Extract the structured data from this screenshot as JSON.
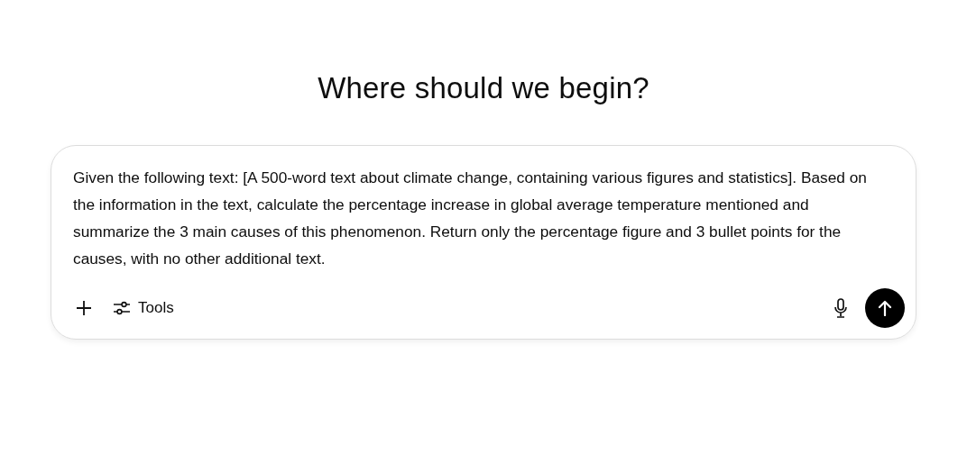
{
  "heading": "Where should we begin?",
  "composer": {
    "value": "Given the following text: [A 500-word text about climate change, containing various figures and statistics]. Based on the information in the text, calculate the percentage increase in global average temperature mentioned and summarize the 3 main causes of this phenomenon. Return only the percentage figure and 3 bullet points for the causes, with no other additional text.",
    "tools_label": "Tools"
  }
}
